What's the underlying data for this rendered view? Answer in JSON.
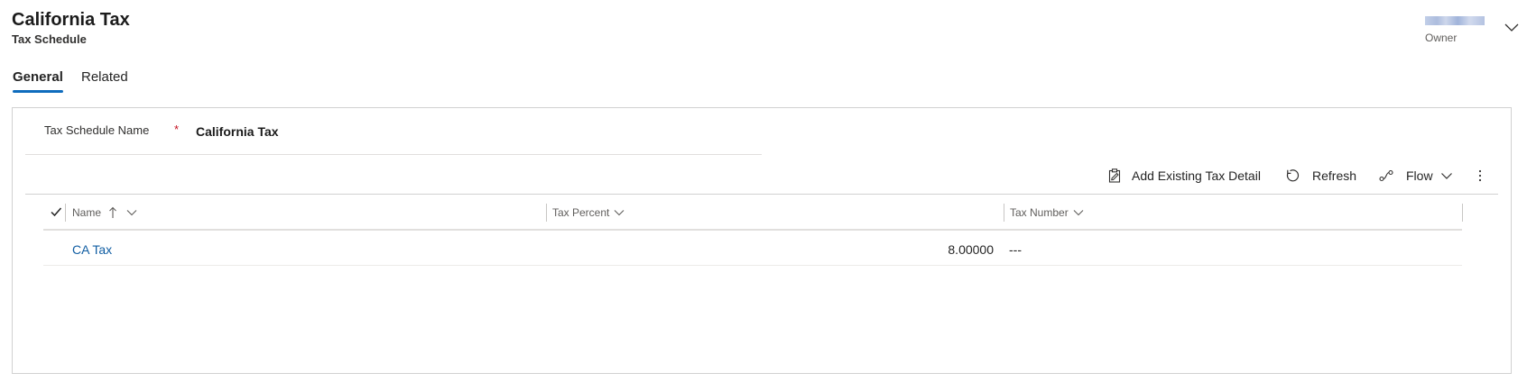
{
  "header": {
    "title": "California Tax",
    "subtitle": "Tax Schedule",
    "owner_label": "Owner"
  },
  "tabs": [
    {
      "label": "General",
      "selected": true
    },
    {
      "label": "Related",
      "selected": false
    }
  ],
  "form": {
    "field_label": "Tax Schedule Name",
    "required_marker": "*",
    "field_value": "California Tax"
  },
  "command_bar": {
    "add_existing_label": "Add Existing Tax Detail",
    "refresh_label": "Refresh",
    "flow_label": "Flow",
    "more_icon": "more-vertical-icon"
  },
  "grid": {
    "columns": [
      {
        "label": "Name",
        "sort": "ascending"
      },
      {
        "label": "Tax Percent"
      },
      {
        "label": "Tax Number"
      }
    ],
    "rows": [
      {
        "name": "CA Tax",
        "tax_percent": "8.00000",
        "tax_number": "---"
      }
    ]
  },
  "colors": {
    "accent": "#0f6cbd",
    "link": "#115ea3",
    "required": "#c50f1f"
  }
}
